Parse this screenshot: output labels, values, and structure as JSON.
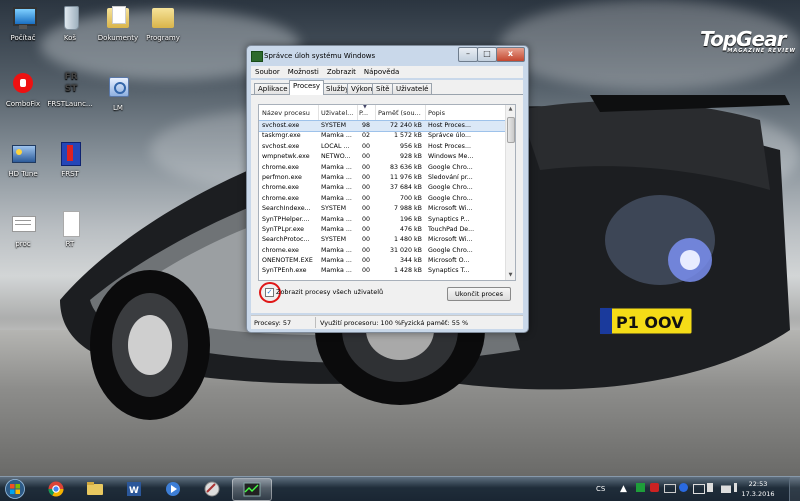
{
  "desktop": {
    "brand": "TopGear",
    "brand_sub": "MAGAZINE REVIEW",
    "plate": "P1 OOV",
    "icons": [
      {
        "name": "pocitac",
        "label": "Počítač"
      },
      {
        "name": "kos",
        "label": "Koš"
      },
      {
        "name": "dokumenty",
        "label": "Dokumenty"
      },
      {
        "name": "programy",
        "label": "Programy"
      },
      {
        "name": "combofix",
        "label": "ComboFix"
      },
      {
        "name": "frstlaunch",
        "label": "FRSTLaunc..."
      },
      {
        "name": "lm",
        "label": "LM"
      },
      {
        "name": "hdtune",
        "label": "HD Tune"
      },
      {
        "name": "frst",
        "label": "FRST"
      },
      {
        "name": "proc",
        "label": "proc"
      },
      {
        "name": "rt",
        "label": "RT"
      }
    ]
  },
  "window": {
    "title": "Správce úloh systému Windows",
    "buttons": {
      "minimize": "–",
      "maximize": "□",
      "close": "x"
    },
    "menu": [
      "Soubor",
      "Možnosti",
      "Zobrazit",
      "Nápověda"
    ],
    "tabs": [
      "Aplikace",
      "Procesy",
      "Služby",
      "Výkon",
      "Sítě",
      "Uživatelé"
    ],
    "active_tab": "Procesy",
    "columns": [
      "Název procesu",
      "Uživatel...",
      "P...",
      "Paměť (sou...",
      "Popis"
    ],
    "rows": [
      [
        "svchost.exe",
        "SYSTEM",
        "98",
        "72 240 kB",
        "Host Proces..."
      ],
      [
        "taskmgr.exe",
        "Mamka ...",
        "02",
        "1 572 kB",
        "Správce úlo..."
      ],
      [
        "svchost.exe",
        "LOCAL ...",
        "00",
        "956 kB",
        "Host Proces..."
      ],
      [
        "wmpnetwk.exe",
        "NETWO...",
        "00",
        "928 kB",
        "Windows Me..."
      ],
      [
        "chrome.exe",
        "Mamka ...",
        "00",
        "83 636 kB",
        "Google Chro..."
      ],
      [
        "perfmon.exe",
        "Mamka ...",
        "00",
        "11 976 kB",
        "Sledování pr..."
      ],
      [
        "chrome.exe",
        "Mamka ...",
        "00",
        "37 684 kB",
        "Google Chro..."
      ],
      [
        "chrome.exe",
        "Mamka ...",
        "00",
        "700 kB",
        "Google Chro..."
      ],
      [
        "SearchIndexe...",
        "SYSTEM",
        "00",
        "7 988 kB",
        "Microsoft Wi..."
      ],
      [
        "SynTPHelper....",
        "Mamka ...",
        "00",
        "196 kB",
        "Synaptics P..."
      ],
      [
        "SynTPLpr.exe",
        "Mamka ...",
        "00",
        "476 kB",
        "TouchPad De..."
      ],
      [
        "SearchProtoc...",
        "SYSTEM",
        "00",
        "1 480 kB",
        "Microsoft Wi..."
      ],
      [
        "chrome.exe",
        "Mamka ...",
        "00",
        "31 020 kB",
        "Google Chro..."
      ],
      [
        "ONENOTEM.EXE",
        "Mamka ...",
        "00",
        "344 kB",
        "Microsoft O..."
      ],
      [
        "SynTPEnh.exe",
        "Mamka ...",
        "00",
        "1 428 kB",
        "Synaptics T..."
      ]
    ],
    "show_all_label": "Zobrazit procesy všech uživatelů",
    "show_all_checked": "✓",
    "end_process_label": "Ukončit proces",
    "status": {
      "processes": "Procesy: 57",
      "cpu": "Využití procesoru: 100 %",
      "memory": "Fyzická paměť: 55 %"
    }
  },
  "taskbar": {
    "apps": [
      "chrome",
      "explorer",
      "word",
      "media-player",
      "sheriff",
      "task-manager"
    ],
    "active_app": "task-manager",
    "tray": {
      "lang": "CS"
    },
    "time": "22:53",
    "date": "17.3.2016"
  }
}
